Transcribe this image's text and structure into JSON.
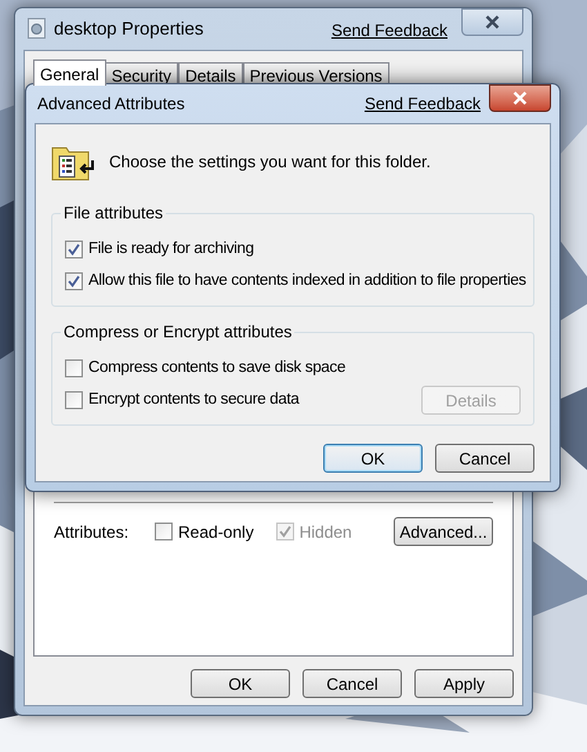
{
  "properties_window": {
    "title": "desktop Properties",
    "feedback_link": "Send Feedback",
    "tabs": [
      {
        "label": "General",
        "selected": true
      },
      {
        "label": "Security",
        "selected": false
      },
      {
        "label": "Details",
        "selected": false
      },
      {
        "label": "Previous Versions",
        "selected": false
      }
    ],
    "attributes": {
      "label": "Attributes:",
      "checkboxes": [
        {
          "label": "Read-only",
          "checked": false,
          "disabled": false
        },
        {
          "label": "Hidden",
          "checked": true,
          "disabled": true
        }
      ],
      "button": "Advanced..."
    },
    "buttons": [
      "OK",
      "Cancel",
      "Apply"
    ]
  },
  "advanced_dialog": {
    "title": "Advanced Attributes",
    "feedback_link": "Send Feedback",
    "prompt": "Choose the settings you want for this folder.",
    "groups": [
      {
        "title": "File attributes",
        "options": [
          {
            "label": "File is ready for archiving",
            "checked": true
          },
          {
            "label": "Allow this file to have contents indexed in addition to file properties",
            "checked": true
          }
        ]
      },
      {
        "title": "Compress or Encrypt attributes",
        "options": [
          {
            "label": "Compress contents to save disk space",
            "checked": false
          },
          {
            "label": "Encrypt contents to secure data",
            "checked": false
          }
        ],
        "button": {
          "label": "Details",
          "disabled": true
        }
      }
    ],
    "buttons": [
      {
        "label": "OK",
        "default": true
      },
      {
        "label": "Cancel",
        "default": false
      }
    ]
  }
}
